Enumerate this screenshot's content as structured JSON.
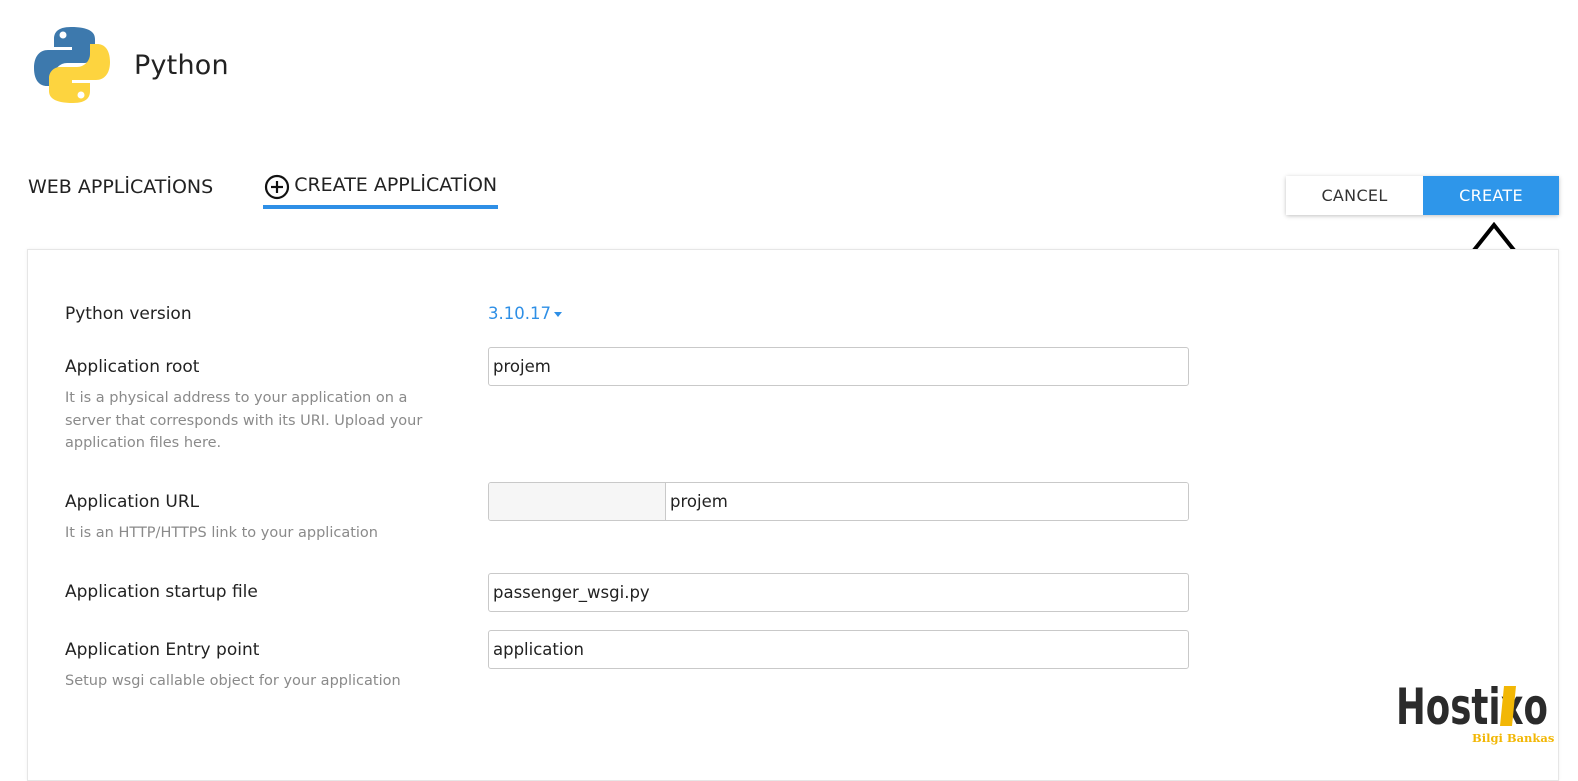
{
  "header": {
    "title": "Python",
    "logo_icon": "python-logo-icon"
  },
  "tabs": [
    {
      "label": "WEB APPLİCATİONS"
    },
    {
      "label": "CREATE APPLİCATİON",
      "icon": "plus-circle-icon",
      "active": true
    }
  ],
  "actions": {
    "cancel_label": "CANCEL",
    "create_label": "CREATE"
  },
  "form": {
    "python_version": {
      "label": "Python version",
      "value": "3.10.17"
    },
    "app_root": {
      "label": "Application root",
      "help": "It is a physical address to your application on a server that corresponds with its URI. Upload your application files here.",
      "value": "projem"
    },
    "app_url": {
      "label": "Application URL",
      "help": "It is an HTTP/HTTPS link to your application",
      "prefix": "",
      "value": "projem"
    },
    "startup_file": {
      "label": "Application startup file",
      "value": "passenger_wsgi.py"
    },
    "entry_point": {
      "label": "Application Entry point",
      "help": "Setup wsgi callable object for your application",
      "value": "application"
    }
  },
  "watermark": {
    "brand": "Hostixo",
    "subtitle": "Bilgi Bankası"
  },
  "colors": {
    "accent": "#2e8fe6",
    "button_primary": "#2e96ea",
    "watermark_accent": "#f2b705"
  }
}
